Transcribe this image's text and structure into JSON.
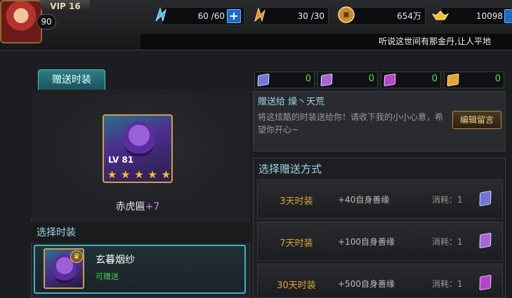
{
  "player": {
    "vip": "VIP 16",
    "level": "90"
  },
  "resources": {
    "stamina": "60 /60",
    "energy": "30 /30",
    "coins": "654万",
    "gold": "10098"
  },
  "marquee": "听说这世间有那金丹,让人平地",
  "tab_label": "赠送时装",
  "preview": {
    "level": "LV 81",
    "stars": 5,
    "name": "赤虎匾",
    "plus": "+7"
  },
  "select_section": {
    "title": "选择时装",
    "item": {
      "name": "玄暮烟纱",
      "status": "可赠送"
    }
  },
  "tokens": [
    {
      "color": "#6f78d8",
      "count": "0"
    },
    {
      "color": "#a466d6",
      "count": "0"
    },
    {
      "color": "#b347c9",
      "count": "0"
    },
    {
      "color": "#e2a52a",
      "count": "0"
    }
  ],
  "gift": {
    "to": "赠送给 燥丶天荒",
    "message": "将这炫酷的时装送给你！请收下我的小小心意，希望你开心~",
    "edit_button": "编辑留言"
  },
  "method": {
    "title": "选择赠送方式",
    "options": [
      {
        "name": "3天时装",
        "bonus": "+40自身善缘",
        "cost": "消耗：1",
        "token_color": "#6f78d8"
      },
      {
        "name": "7天时装",
        "bonus": "+100自身善缘",
        "cost": "消耗：1",
        "token_color": "#a466d6"
      },
      {
        "name": "30天时装",
        "bonus": "+500自身善缘",
        "cost": "消耗：1",
        "token_color": "#b347c9"
      }
    ]
  }
}
